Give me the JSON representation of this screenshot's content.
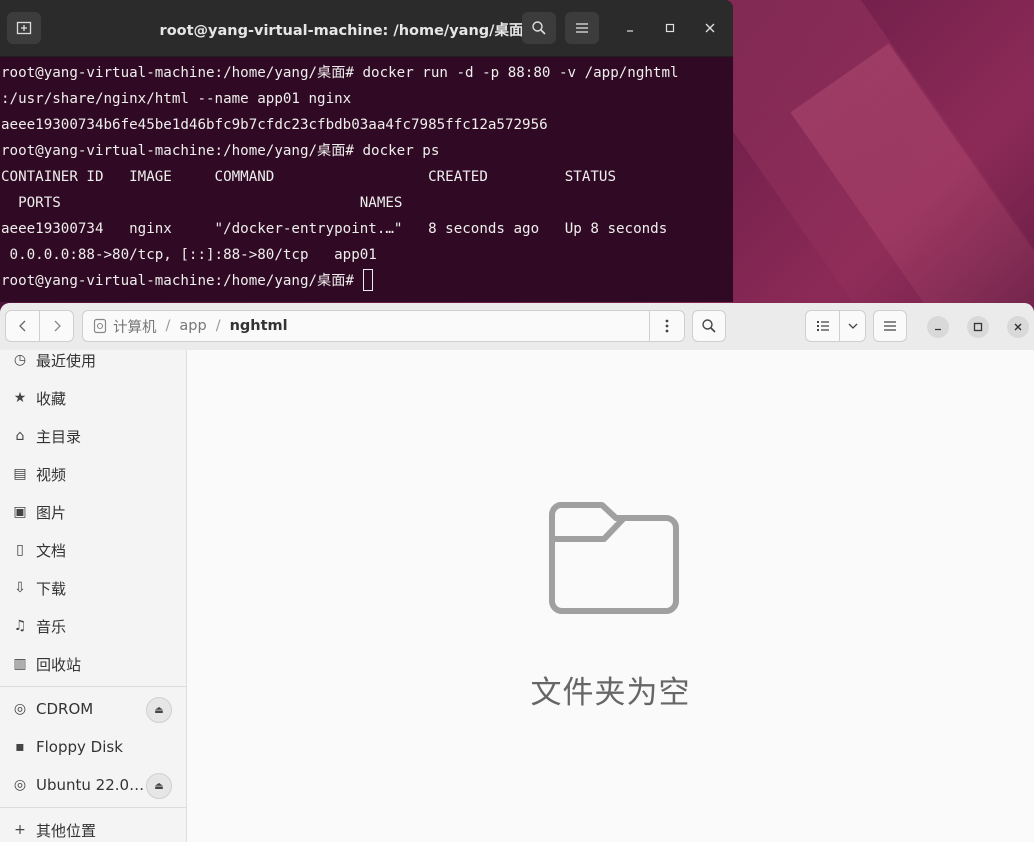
{
  "terminal": {
    "title": "root@yang-virtual-machine: /home/yang/桌面",
    "lines": [
      "root@yang-virtual-machine:/home/yang/桌面# docker run -d -p 88:80 -v /app/nghtml",
      ":/usr/share/nginx/html --name app01 nginx",
      "aeee19300734b6fe45be1d46bfc9b7cfdc23cfbdb03aa4fc7985ffc12a572956",
      "root@yang-virtual-machine:/home/yang/桌面# docker ps",
      "CONTAINER ID   IMAGE     COMMAND                  CREATED         STATUS",
      "  PORTS                                   NAMES",
      "aeee19300734   nginx     \"/docker-entrypoint.…\"   8 seconds ago   Up 8 seconds",
      " 0.0.0.0:88->80/tcp, [::]:88->80/tcp   app01"
    ],
    "prompt": "root@yang-virtual-machine:/home/yang/桌面# "
  },
  "files": {
    "path": [
      "计算机",
      "app",
      "nghtml"
    ],
    "sidebar": [
      {
        "label": "最近使用",
        "icon": "clock-icon",
        "glyph": "◷"
      },
      {
        "label": "收藏",
        "icon": "star-icon",
        "glyph": "★"
      },
      {
        "label": "主目录",
        "icon": "home-icon",
        "glyph": "⌂"
      },
      {
        "label": "视频",
        "icon": "film-icon",
        "glyph": "▤"
      },
      {
        "label": "图片",
        "icon": "image-icon",
        "glyph": "▣"
      },
      {
        "label": "文档",
        "icon": "document-icon",
        "glyph": "▯"
      },
      {
        "label": "下载",
        "icon": "download-icon",
        "glyph": "⇩"
      },
      {
        "label": "音乐",
        "icon": "music-icon",
        "glyph": "♫"
      },
      {
        "label": "回收站",
        "icon": "trash-icon",
        "glyph": "▥"
      }
    ],
    "devices": [
      {
        "label": "CDROM",
        "icon": "disc-icon",
        "glyph": "◎",
        "eject": true
      },
      {
        "label": "Floppy Disk",
        "icon": "floppy-icon",
        "glyph": "▪",
        "eject": false
      },
      {
        "label": "Ubuntu 22.0…",
        "icon": "disc-icon",
        "glyph": "◎",
        "eject": true
      }
    ],
    "other_locations": "其他位置",
    "empty_message": "文件夹为空"
  }
}
